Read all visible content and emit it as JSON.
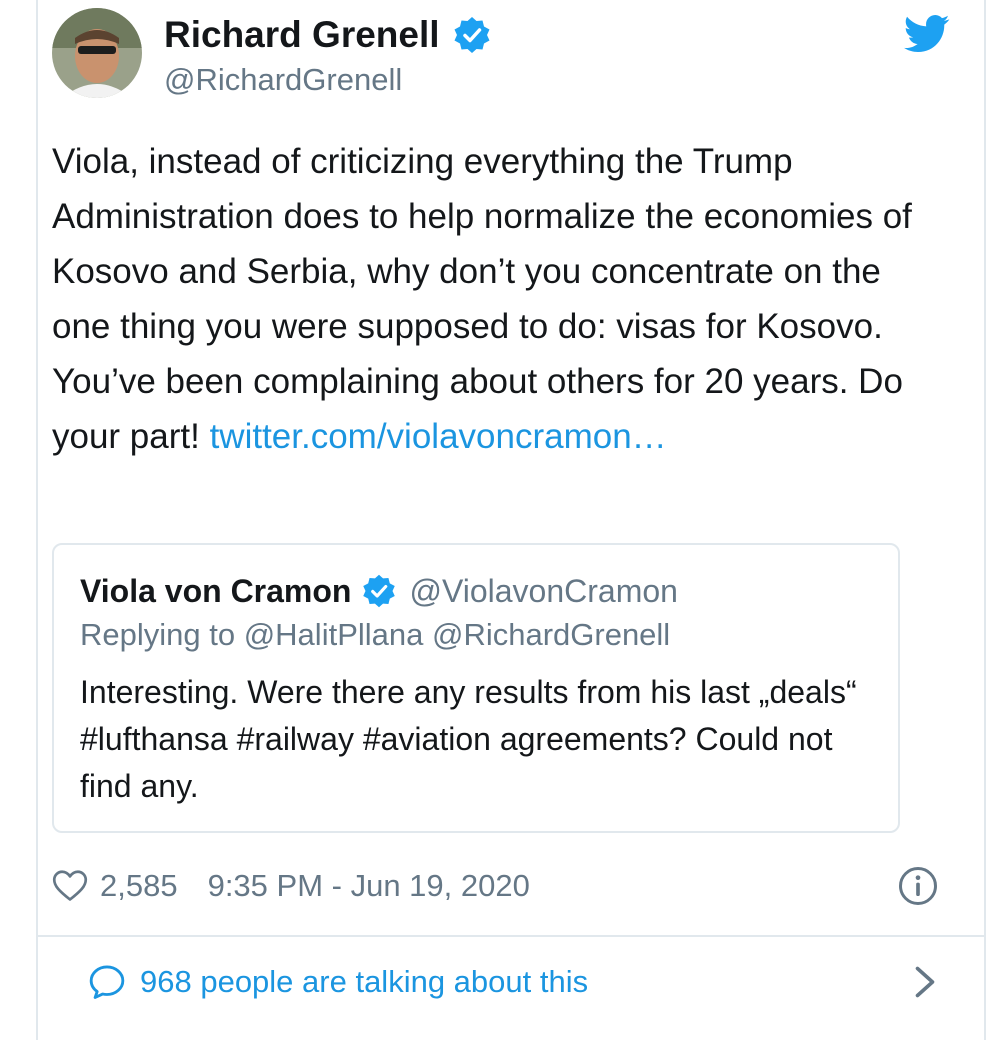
{
  "author": {
    "name": "Richard Grenell",
    "handle": "@RichardGrenell",
    "verified_icon": "verified-badge-icon"
  },
  "tweet": {
    "text": "Viola, instead of criticizing everything the Trump Administration does to help normalize the economies of Kosovo and Serbia, why don’t you concentrate on the one thing you were supposed to do: visas for Kosovo. You’ve been complaining about others for 20 years. Do your part! ",
    "link_text": "twitter.com/violavoncramon…"
  },
  "quoted_tweet": {
    "name": "Viola von Cramon",
    "handle": "@ViolavonCramon",
    "replying_to": "Replying to @HalitPllana @RichardGrenell",
    "text": "Interesting. Were there any results from his last „deals“ #lufthansa #railway #aviation agreements? Could not find any."
  },
  "meta": {
    "likes": "2,585",
    "timestamp": "9:35 PM - Jun 19, 2020"
  },
  "footer": {
    "talking_label": "968 people are talking about this"
  },
  "colors": {
    "link": "#1b95e0",
    "secondary_text": "#657786",
    "border": "#e1e8ed",
    "verified": "#1da1f2"
  }
}
